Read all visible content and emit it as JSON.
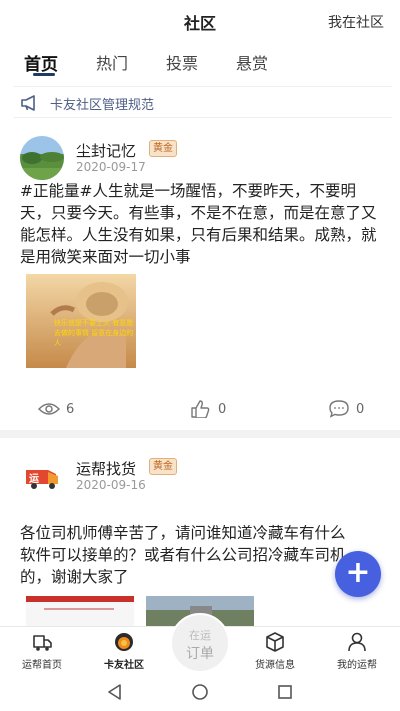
{
  "header": {
    "title": "社区",
    "right_link": "我在社区"
  },
  "tabs": [
    {
      "label": "首页",
      "active": true
    },
    {
      "label": "热门",
      "active": false
    },
    {
      "label": "投票",
      "active": false
    },
    {
      "label": "悬赏",
      "active": false
    }
  ],
  "notice": {
    "text": "卡友社区管理规范",
    "icon": "megaphone-icon"
  },
  "posts": [
    {
      "author": "尘封记忆",
      "badge": "黄金",
      "date": "2020-09-17",
      "content": "#正能量#人生就是一场醒悟，不要昨天，不要明天，只要今天。有些事，不是不在意，而是在意了又能怎样。人生没有如果，只有后果和结果。成熟，就是用微笑来面对一切小事",
      "image_overlay_text": "快乐就是不要上火 有意愿去做的事情 留意在身边的人",
      "views": "6",
      "likes": "0",
      "comments": "0"
    },
    {
      "author": "运帮找货",
      "badge": "黄金",
      "date": "2020-09-16",
      "content": "各位司机师傅辛苦了，请问谁知道冷藏车有什么软件可以接单的？或者有什么公司招冷藏车司机的，谢谢大家了"
    }
  ],
  "fab": {
    "label": "+"
  },
  "bottom_nav": {
    "items": [
      {
        "label": "运帮首页",
        "icon": "home-truck-icon"
      },
      {
        "label": "卡友社区",
        "icon": "community-icon",
        "active": true
      },
      {
        "label": "货源信息",
        "icon": "cube-icon"
      },
      {
        "label": "我的运帮",
        "icon": "user-icon"
      }
    ],
    "center": {
      "line1": "在运",
      "line2": "订单"
    }
  },
  "colors": {
    "accent": "#4660e0",
    "tab_underline": "#1f3b63",
    "badge_bg": "#f7e3c9",
    "badge_text": "#c0661e",
    "notice_text": "#4d5f86"
  }
}
